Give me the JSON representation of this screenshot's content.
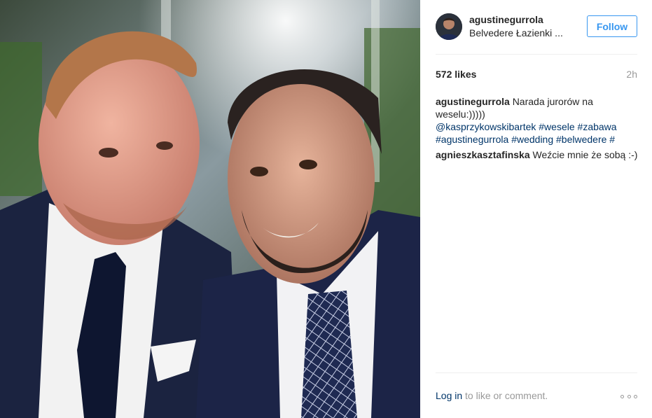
{
  "post": {
    "photo": {
      "description_icon": "selfie-photo"
    },
    "header": {
      "username": "agustinegurrola",
      "location": "Belvedere Łazienki ...",
      "follow_label": "Follow"
    },
    "likes": "572 likes",
    "time": "2h",
    "comments": [
      {
        "user": "agustinegurrola",
        "text": "Narada jurorów na weselu:)))))",
        "tags": [
          "@kasprzykowskibartek",
          "#wesele",
          "#zabawa",
          "#agustinegurrola",
          "#wedding",
          "#belwedere",
          "#"
        ]
      },
      {
        "user": "agnieszkasztafinska",
        "text": "Weźcie mnie że sobą :-)"
      }
    ],
    "footer": {
      "login_label": "Log in",
      "prompt_text": "to like or comment."
    }
  },
  "colors": {
    "link": "#003569",
    "follow": "#3897f0",
    "muted": "#999999"
  }
}
